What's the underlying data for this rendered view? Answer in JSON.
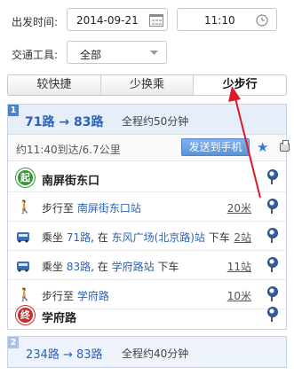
{
  "form": {
    "depart_label": "出发时间:",
    "date_value": "2014-09-21",
    "time_value": "11:10",
    "tool_label": "交通工具:",
    "tool_value": "全部"
  },
  "tabs": [
    {
      "label": "较快捷",
      "active": false
    },
    {
      "label": "少换乘",
      "active": false
    },
    {
      "label": "少步行",
      "active": true
    }
  ],
  "plan1": {
    "index": "1",
    "title": "71路 → 83路",
    "total": "全程约50分钟",
    "arrive_info": "约11:40到达/6.7公里",
    "send_button": "发送到手机",
    "start_badge": "起",
    "start_name": "南屏街东口",
    "end_badge": "终",
    "end_name": "学府路",
    "steps": [
      {
        "type": "walk",
        "pre": "步行至 ",
        "hl": "南屏街东口站",
        "post": "",
        "dist": "20米"
      },
      {
        "type": "bus",
        "pre": "乘坐 ",
        "hl": "71路",
        "mid": ", 在 ",
        "hl2": "东风广场(北京路)站",
        "post": " 下车",
        "dist": "2站"
      },
      {
        "type": "bus",
        "pre": "乘坐 ",
        "hl": "83路",
        "mid": ", 在 ",
        "hl2": "学府路站",
        "post": " 下车",
        "dist": "11站"
      },
      {
        "type": "walk",
        "pre": "步行至 ",
        "hl": "学府路",
        "post": "",
        "dist": "10米"
      }
    ]
  },
  "plan2": {
    "index": "2",
    "title": "234路 → 83路",
    "total": "全程约40分钟"
  },
  "colors": {
    "accent": "#2b64b4",
    "arrow": "#e0182a",
    "start": "#2f9a2f",
    "end": "#c22f2f"
  }
}
